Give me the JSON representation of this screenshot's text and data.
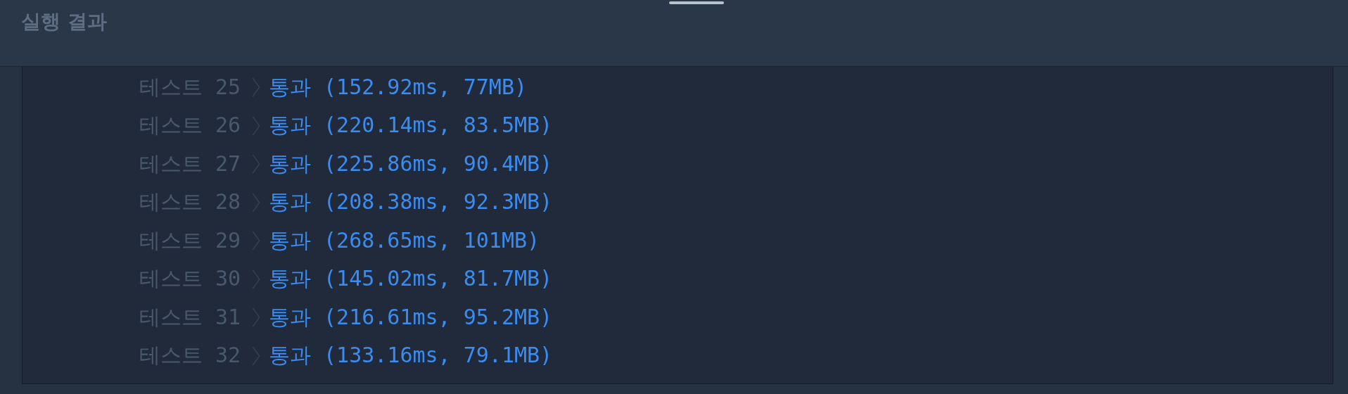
{
  "panel": {
    "title": "실행 결과"
  },
  "results": [
    {
      "label": "테스트 25",
      "kind": "pass",
      "verdict": "통과",
      "detail": "(152.92ms, 77MB)"
    },
    {
      "label": "테스트 26",
      "kind": "pass",
      "verdict": "통과",
      "detail": "(220.14ms, 83.5MB)"
    },
    {
      "label": "테스트 27",
      "kind": "pass",
      "verdict": "통과",
      "detail": "(225.86ms, 90.4MB)"
    },
    {
      "label": "테스트 28",
      "kind": "pass",
      "verdict": "통과",
      "detail": "(208.38ms, 92.3MB)"
    },
    {
      "label": "테스트 29",
      "kind": "pass",
      "verdict": "통과",
      "detail": "(268.65ms, 101MB)"
    },
    {
      "label": "테스트 30",
      "kind": "pass",
      "verdict": "통과",
      "detail": "(145.02ms, 81.7MB)"
    },
    {
      "label": "테스트 31",
      "kind": "pass",
      "verdict": "통과",
      "detail": "(216.61ms, 95.2MB)"
    },
    {
      "label": "테스트 32",
      "kind": "pass",
      "verdict": "통과",
      "detail": "(133.16ms, 79.1MB)"
    }
  ]
}
